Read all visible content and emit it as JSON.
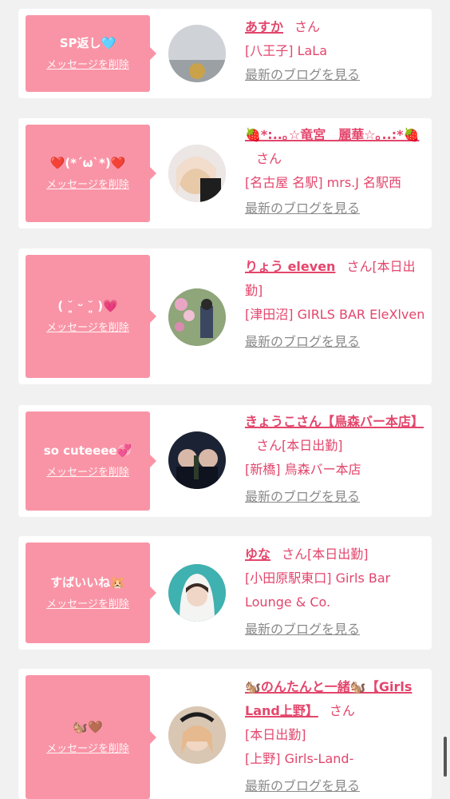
{
  "cards": [
    {
      "message": "SP返し🩵",
      "delete_label": "メッセージを削除",
      "name": "あすか",
      "san": "さん",
      "place": "[八王子] LaLa",
      "blog_link": "最新のブログを見る"
    },
    {
      "message": "❤️(*´ω`*)❤️",
      "delete_label": "メッセージを削除",
      "name": "🍓*:..｡☆竜宮　麗華☆｡..:*🍓",
      "san": "さん",
      "place": "[名古屋 名駅] mrs.J 名駅西",
      "blog_link": "最新のブログを見る"
    },
    {
      "message": "( ˘͈ ᵕ ˘͈ )💗",
      "delete_label": "メッセージを削除",
      "name": "りょう eleven",
      "san": "さん[本日出勤]",
      "place": "[津田沼] GIRLS BAR EleXlven",
      "blog_link": "最新のブログを見る"
    },
    {
      "message": "so cuteeee💞",
      "delete_label": "メッセージを削除",
      "name": "きょうこさん【鳥森バー本店】",
      "san": "さん[本日出勤]",
      "place": "[新橋] 鳥森バー本店",
      "blog_link": "最新のブログを見る"
    },
    {
      "message": "すばいいね🐹",
      "delete_label": "メッセージを削除",
      "name": "ゆな",
      "san": "さん[本日出勤]",
      "place": "[小田原駅東口] Girls Bar Lounge & Co.",
      "blog_link": "最新のブログを見る"
    },
    {
      "message": "🐿️🤎",
      "delete_label": "メッセージを削除",
      "name": "🐿️のんたんと一緒🐿️【Girls Land上野】",
      "san": "さん",
      "place_line1": "[本日出勤]",
      "place": "[上野] Girls-Land-",
      "blog_link": "最新のブログを見る"
    }
  ]
}
